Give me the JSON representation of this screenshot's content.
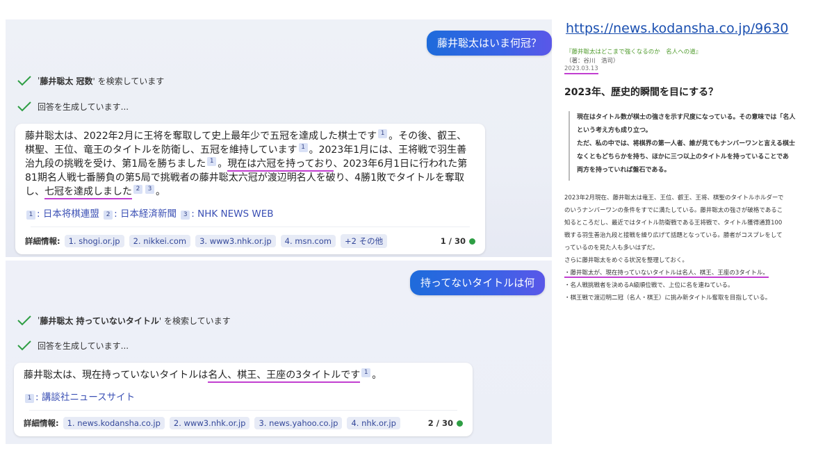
{
  "chat": {
    "turn1": {
      "user_message": "藤井聡太はいま何冠？",
      "status_search_prefix": "'",
      "status_search_query": "藤井聡太 冠数",
      "status_search_suffix": "' を検索しています",
      "status_generating": "回答を生成しています...",
      "answer": {
        "p1": "藤井聡太は、2022年2月に王将を奪取して史上最年少で五冠を達成した棋士です",
        "r1": "1",
        "p2": "。その後、叡王、棋聖、王位、竜王のタイトルを防衛し、五冠を維持しています",
        "r2": "1",
        "p3": "。2023年1月には、王将戦で羽生善治九段の挑戦を受け、第1局を勝ちました",
        "r3": "1",
        "p4": "。",
        "p5_highlight": "現在は六冠を持っており",
        "p6": "、2023年6月1日に行われた第81期名人戦七番勝負の第5局で挑戦者の藤井聡太六冠が渡辺明名人を破り、4勝1敗でタイトルを奪取し、",
        "p7_highlight": "七冠を達成しました",
        "r4": "2",
        "r5": "3",
        "p8": "。"
      },
      "sources": [
        {
          "num": "1",
          "name": "日本将棋連盟"
        },
        {
          "num": "2",
          "name": "日本経済新聞"
        },
        {
          "num": "3",
          "name": "NHK NEWS WEB"
        }
      ],
      "details_label": "詳細情報:",
      "chips": [
        "1. shogi.or.jp",
        "2. nikkei.com",
        "3. www3.nhk.or.jp",
        "4. msn.com",
        "+2 その他"
      ],
      "counter": "1 / 30"
    },
    "turn2": {
      "user_message": "持ってないタイトルは何",
      "status_search_prefix": "'",
      "status_search_query": "藤井聡太 持っていないタイトル",
      "status_search_suffix": "' を検索しています",
      "status_generating": "回答を生成しています...",
      "answer": {
        "p1": "藤井聡太は、現在持っていないタイトルは",
        "p2_highlight": "名人、棋王、王座の3タイトルです",
        "r1": "1",
        "p3": "。"
      },
      "sources": [
        {
          "num": "1",
          "name": "講談社ニュースサイト"
        }
      ],
      "details_label": "詳細情報:",
      "chips": [
        "1. news.kodansha.co.jp",
        "2. www3.nhk.or.jp",
        "3. news.yahoo.co.jp",
        "4. nhk.or.jp"
      ],
      "counter": "2 / 30"
    }
  },
  "article": {
    "url": "https://news.kodansha.co.jp/9630",
    "series_title": "『藤井聡太はどこまで強くなるのか　名人への道』",
    "author": "（著：谷川　浩司）",
    "date": "2023.03.13",
    "heading": "2023年、歴史的瞬間を目にする？",
    "quote_lines": [
      "現在はタイトル数が棋士の強さを示す尺度になっている。その意味では「名人",
      "という考え方も成り立つ。",
      "ただ、私の中では、将棋界の第一人者、誰が見てもナンバーワンと言える棋士",
      "なくともどちらかを持ち、ほかに三つ以上のタイトルを持っていることであ",
      "両方を持っていれば盤石である。"
    ],
    "body_lines": [
      "2023年2月現在、藤井聡太は竜王、王位、叡王、王将、棋聖のタイトルホルダーで",
      "のいうナンバーワンの条件をすでに満たしている。藤井聡太の強さが破格であるこ",
      "知るところだし、最近ではタイトル防衛戦である王将戦で、タイトル獲得通算100",
      "戦する羽生善治九段と接戦を繰り広げて話題となっている。勝者がコスプレをして",
      "っているのを見た人も多いはずだ。",
      "さらに藤井聡太をめぐる状況を整理しておく。"
    ],
    "bullet_highlight": "・藤井聡太が、現在持っていないタイトルは名人、棋王、王座の3タイトル。",
    "bullet_2": "・名人戦挑戦者を決めるA級順位戦で、上位に名を連ねている。",
    "bullet_3": "・棋王戦で渡辺明二冠（名人・棋王）に挑み新タイトル奪取を目指している。"
  },
  "colors": {
    "accent_blue": "#3a63e6",
    "highlight_magenta": "#c13ed0",
    "check_green": "#2e9e44",
    "link_blue": "#1a4fb0"
  }
}
